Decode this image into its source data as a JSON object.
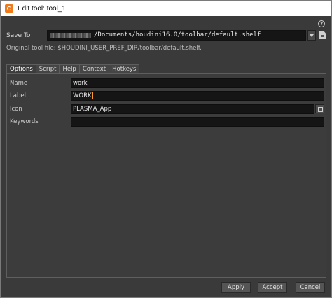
{
  "window": {
    "title": "Edit tool: tool_1",
    "help_symbol": "?"
  },
  "save_to": {
    "label": "Save To",
    "path_visible": "/Documents/houdini16.0/toolbar/default.shelf"
  },
  "original_file": "Original tool file: $HOUDINI_USER_PREF_DIR/toolbar/default.shelf.",
  "tabs": [
    {
      "label": "Options",
      "active": true
    },
    {
      "label": "Script",
      "active": false
    },
    {
      "label": "Help",
      "active": false
    },
    {
      "label": "Context",
      "active": false
    },
    {
      "label": "Hotkeys",
      "active": false
    }
  ],
  "fields": {
    "name": {
      "label": "Name",
      "value": "work"
    },
    "label": {
      "label": "Label",
      "value": "WORK"
    },
    "icon": {
      "label": "Icon",
      "value": "PLASMA_App"
    },
    "keywords": {
      "label": "Keywords",
      "value": ""
    }
  },
  "buttons": {
    "apply": "Apply",
    "accept": "Accept",
    "cancel": "Cancel"
  },
  "colors": {
    "background": "#3a3a3a",
    "field_bg": "#151515",
    "caret": "#ff9a2a",
    "app_icon": "#f07a1a"
  }
}
